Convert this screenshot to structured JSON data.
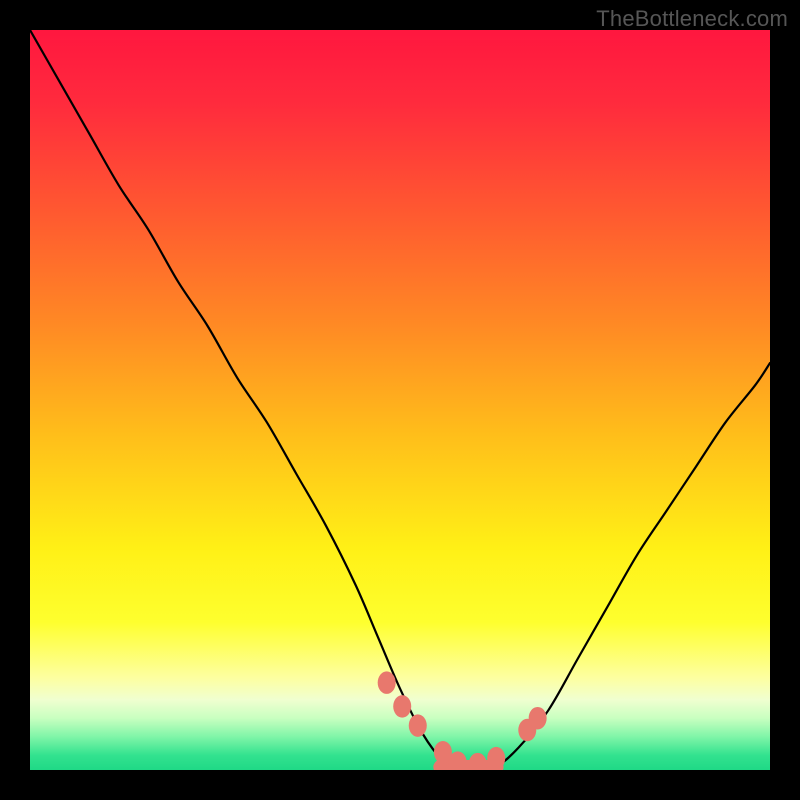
{
  "watermark": "TheBottleneck.com",
  "gradient_stops": [
    {
      "offset": 0.0,
      "color": "#ff173f"
    },
    {
      "offset": 0.1,
      "color": "#ff2b3d"
    },
    {
      "offset": 0.25,
      "color": "#ff5a30"
    },
    {
      "offset": 0.4,
      "color": "#ff8a24"
    },
    {
      "offset": 0.55,
      "color": "#ffbf1a"
    },
    {
      "offset": 0.7,
      "color": "#fff016"
    },
    {
      "offset": 0.8,
      "color": "#feff2e"
    },
    {
      "offset": 0.875,
      "color": "#fdffa0"
    },
    {
      "offset": 0.905,
      "color": "#f0ffd0"
    },
    {
      "offset": 0.93,
      "color": "#c8ffc0"
    },
    {
      "offset": 0.955,
      "color": "#80f5a8"
    },
    {
      "offset": 0.98,
      "color": "#33e28f"
    },
    {
      "offset": 1.0,
      "color": "#1fd986"
    }
  ],
  "curve": {
    "stroke": "#000000",
    "stroke_width": 2.2
  },
  "marker": {
    "fill": "#e8786d",
    "rx": 9
  },
  "chart_data": {
    "type": "line",
    "title": "",
    "xlabel": "",
    "ylabel": "",
    "xlim": [
      0,
      100
    ],
    "ylim": [
      0,
      100
    ],
    "series": [
      {
        "name": "bottleneck-curve",
        "x": [
          0,
          4,
          8,
          12,
          16,
          20,
          24,
          28,
          32,
          36,
          40,
          44,
          47,
          50,
          53,
          56,
          58,
          60,
          63,
          66,
          70,
          74,
          78,
          82,
          86,
          90,
          94,
          98,
          100
        ],
        "y": [
          100,
          93,
          86,
          79,
          73,
          66,
          60,
          53,
          47,
          40,
          33,
          25,
          18,
          11,
          5,
          1,
          0,
          0,
          0.5,
          3,
          8,
          15,
          22,
          29,
          35,
          41,
          47,
          52,
          55
        ]
      }
    ],
    "markers": {
      "name": "highlight-dots",
      "points_xy": [
        [
          48.2,
          11.8
        ],
        [
          50.3,
          8.6
        ],
        [
          52.4,
          6.0
        ],
        [
          55.8,
          2.4
        ],
        [
          57.8,
          1.0
        ],
        [
          60.5,
          0.8
        ],
        [
          63.0,
          1.6
        ],
        [
          67.2,
          5.4
        ],
        [
          68.6,
          7.0
        ]
      ]
    },
    "flat_bar": {
      "x_start": 54.5,
      "x_end": 64.0,
      "y": 0.4
    }
  }
}
